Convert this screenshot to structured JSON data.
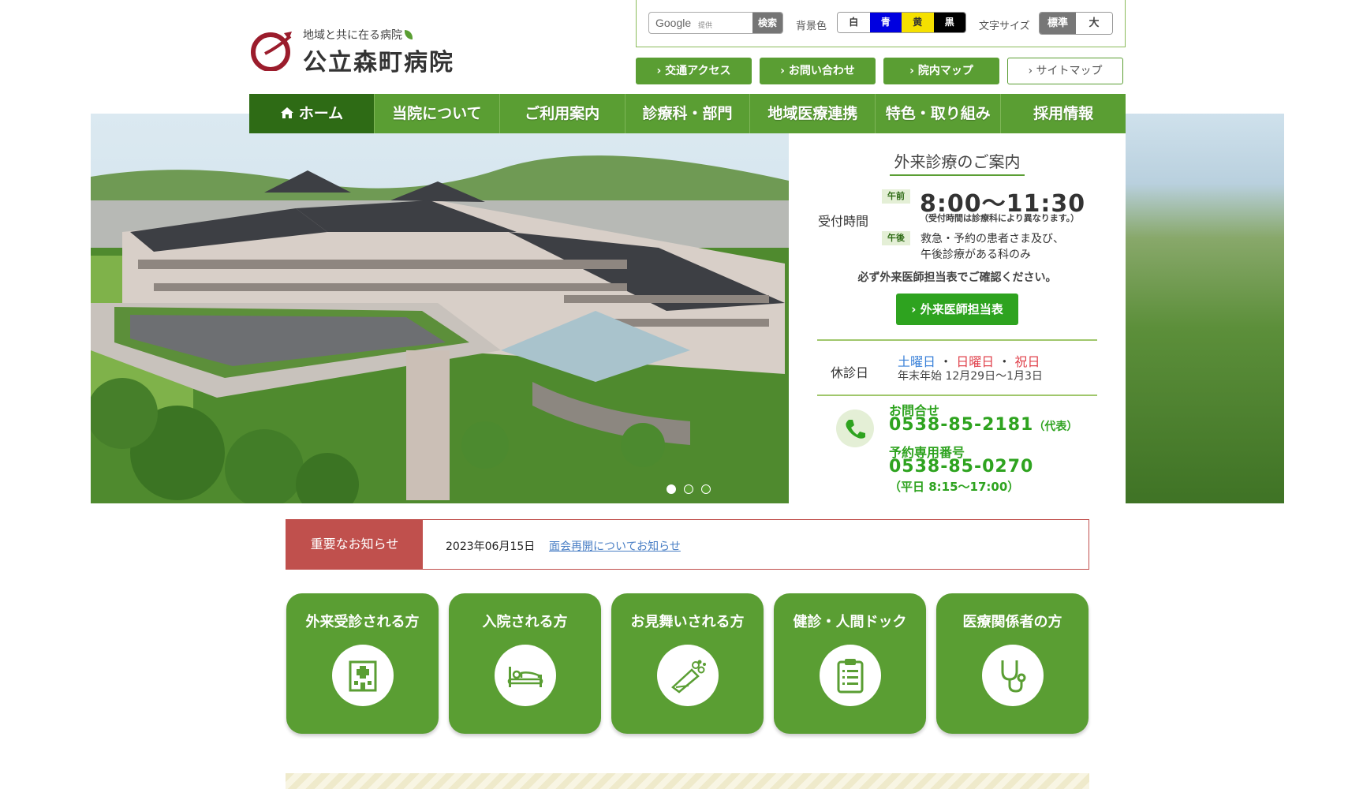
{
  "header": {
    "logo_tagline": "地域と共に在る病院",
    "logo_name": "公立森町病院"
  },
  "utility": {
    "search_brand": "Google",
    "search_sub": "提供",
    "search_button": "検索",
    "bg_label": "背景色",
    "bg_options": [
      "白",
      "青",
      "黄",
      "黒"
    ],
    "fs_label": "文字サイズ",
    "fs_options": [
      "標準",
      "大"
    ]
  },
  "quick_links": [
    "交通アクセス",
    "お問い合わせ",
    "院内マップ",
    "サイトマップ"
  ],
  "nav": [
    "ホーム",
    "当院について",
    "ご利用案内",
    "診療科・部門",
    "地域医療連携",
    "特色・取り組み",
    "採用情報"
  ],
  "outpatient": {
    "title": "外来診療のご案内",
    "reception_label": "受付時間",
    "am_badge": "午前",
    "am_time": "8:00〜11:30",
    "am_note": "（受付時間は診療科により異なります。）",
    "pm_badge": "午後",
    "pm_line1": "救急・予約の患者さま及び、",
    "pm_line2": "午後診療がある科のみ",
    "confirm": "必ず外来医師担当表でご確認ください。",
    "doctor_button": "外来医師担当表",
    "holiday_label": "休診日",
    "holiday_sat": "土曜日",
    "holiday_sun": "日曜日",
    "holiday_nat": "祝日",
    "holiday_sep": "・",
    "holiday_sub": "年末年始  12月29日〜1月3日",
    "tel_label": "お問合せ",
    "tel_main": "0538-85-2181",
    "tel_main_note": "（代表）",
    "tel_res_label": "予約専用番号",
    "tel_res": "0538-85-0270",
    "tel_res_hours": "（平日 8:15〜17:00）"
  },
  "slider": {
    "count": 3,
    "active": 1
  },
  "notice": {
    "label": "重要なお知らせ",
    "date": "2023年06月15日",
    "link": "面会再開についてお知らせ"
  },
  "cards": [
    {
      "label": "外来受診される方",
      "icon": "hospital-icon"
    },
    {
      "label": "入院される方",
      "icon": "bed-icon"
    },
    {
      "label": "お見舞いされる方",
      "icon": "bouquet-icon"
    },
    {
      "label": "健診・人間ドック",
      "icon": "clipboard-icon"
    },
    {
      "label": "医療関係者の方",
      "icon": "stethoscope-icon"
    }
  ],
  "colors": {
    "primary_green": "#5a9e33",
    "nav_active": "#2e6b15",
    "accent_green": "#2ea31f",
    "notice_red": "#c0504d",
    "saturday_blue": "#3b82d9",
    "holiday_red": "#e0434d"
  }
}
